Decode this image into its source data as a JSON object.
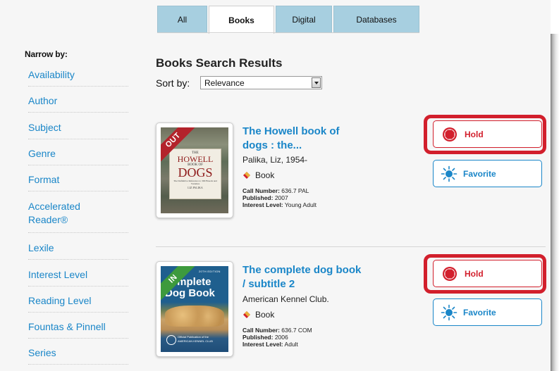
{
  "tabs": [
    {
      "label": "All",
      "active": false
    },
    {
      "label": "Books",
      "active": true
    },
    {
      "label": "Digital",
      "active": false
    },
    {
      "label": "Databases",
      "active": false
    }
  ],
  "sidebar": {
    "title": "Narrow by:",
    "facets": [
      {
        "label": "Availability"
      },
      {
        "label": "Author"
      },
      {
        "label": "Subject"
      },
      {
        "label": "Genre"
      },
      {
        "label": "Format"
      },
      {
        "label": "Accelerated Reader®"
      },
      {
        "label": "Lexile"
      },
      {
        "label": "Interest Level"
      },
      {
        "label": "Reading Level"
      },
      {
        "label": "Fountas & Pinnell"
      },
      {
        "label": "Series"
      }
    ]
  },
  "main": {
    "title": "Books Search Results",
    "sort_label": "Sort by:",
    "sort_value": "Relevance"
  },
  "labels": {
    "call_number": "Call Number:",
    "published": "Published:",
    "interest_level": "Interest Level:",
    "hold": "Hold",
    "favorite": "Favorite"
  },
  "results": [
    {
      "title": "The Howell book of dogs : the...",
      "author": "Palika, Liz, 1954-",
      "format": "Book",
      "call_number": "636.7 PAL",
      "published": "2007",
      "interest_level": "Young Adult",
      "status_ribbon": "OUT",
      "cover": {
        "line1": "THE",
        "line2": "HOWELL",
        "line3": "BOOK OF",
        "line4": "DOGS",
        "line5": "The Definitive Reference to 300 Breeds and Varieties",
        "line6": "LIZ PALIKA"
      }
    },
    {
      "title": "The complete dog book / subtitle 2",
      "author": "American Kennel Club.",
      "format": "Book",
      "call_number": "636.7 COM",
      "published": "2006",
      "interest_level": "Adult",
      "status_ribbon": "IN",
      "cover": {
        "line1": "20TH EDITION",
        "line2": "omplete",
        "line3": "Dog Book",
        "line4": "Official Publication of the",
        "line5": "AMERICAN KENNEL CLUB"
      }
    }
  ],
  "colors": {
    "accent_blue": "#1a86c8",
    "hold_red": "#d21f2c",
    "tab_blue": "#a7cfe0",
    "out_ribbon": "#b3232b",
    "in_ribbon": "#3d9a3d"
  },
  "icons": {
    "hold": "stop-octagon-icon",
    "favorite": "sunburst-star-icon",
    "format": "book-icon"
  }
}
